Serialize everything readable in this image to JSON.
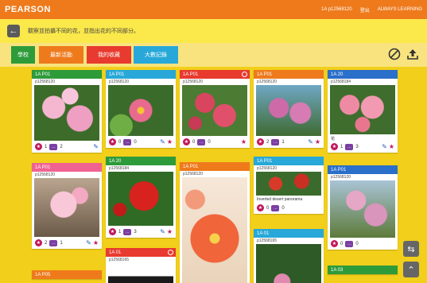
{
  "topbar": {
    "brand": "PEARSON",
    "user": "1A p12568120",
    "logout": "登出",
    "product": "ALWAYS LEARNING"
  },
  "instruction": {
    "text": "觀察並拍攝不同的花，並指出花的不同部分。"
  },
  "tabs": [
    {
      "label": "學校",
      "color": "#2e9b3a"
    },
    {
      "label": "最新活動",
      "color": "#ee7a1c"
    },
    {
      "label": "我的收藏",
      "color": "#e83a2e"
    },
    {
      "label": "大數記錄",
      "color": "#27a8d8"
    }
  ],
  "toolbar": {
    "hide_icon": "no-entry-icon",
    "upload_icon": "upload-icon"
  },
  "cards": [
    {
      "head": "1A P01",
      "color": "#2e9b3a",
      "user": "p12568120",
      "likes": "1",
      "comments": "2"
    },
    {
      "head": "1A P01",
      "color": "#27a8d8",
      "user": "p12568120",
      "likes": "0",
      "comments": "0"
    },
    {
      "head": "1A P01",
      "color": "#e83a2e",
      "user": "p12568120",
      "likes": "0",
      "comments": "0"
    },
    {
      "head": "1A P01",
      "color": "#ee7a1c",
      "user": "p12568120",
      "likes": "2",
      "comments": "1"
    },
    {
      "head": "1A 20",
      "color": "#2a6fc9",
      "user": "p12568184",
      "caption": "花",
      "likes": "1",
      "comments": "3"
    },
    {
      "head": "1A P01",
      "color": "#f06292",
      "user": "p12568120",
      "likes": "2",
      "comments": "1"
    },
    {
      "head": "1A 20",
      "color": "#2e9b3a",
      "user": "p12568184",
      "likes": "1",
      "comments": "3"
    },
    {
      "head": "1A P01",
      "color": "#ee7a1c",
      "user": "p12568120"
    },
    {
      "head": "1A P01",
      "color": "#27a8d8",
      "user": "p12568120",
      "caption": "Inverted desert panorama",
      "likes": "0",
      "comments": "0"
    },
    {
      "head": "1A P01",
      "color": "#2a6fc9",
      "user": "p12568120",
      "likes": "0",
      "comments": "0"
    },
    {
      "head": "1A 01",
      "color": "#e83a2e",
      "user": "p12568165"
    },
    {
      "head": "1A 01",
      "color": "#27a8d8",
      "user": "p12568165"
    },
    {
      "head": "1A P05",
      "color": "#ee7a1c"
    },
    {
      "head": "1A 03",
      "color": "#2e9b3a"
    }
  ],
  "side": {
    "refresh": "refresh-icon",
    "top": "arrow-up-icon"
  }
}
